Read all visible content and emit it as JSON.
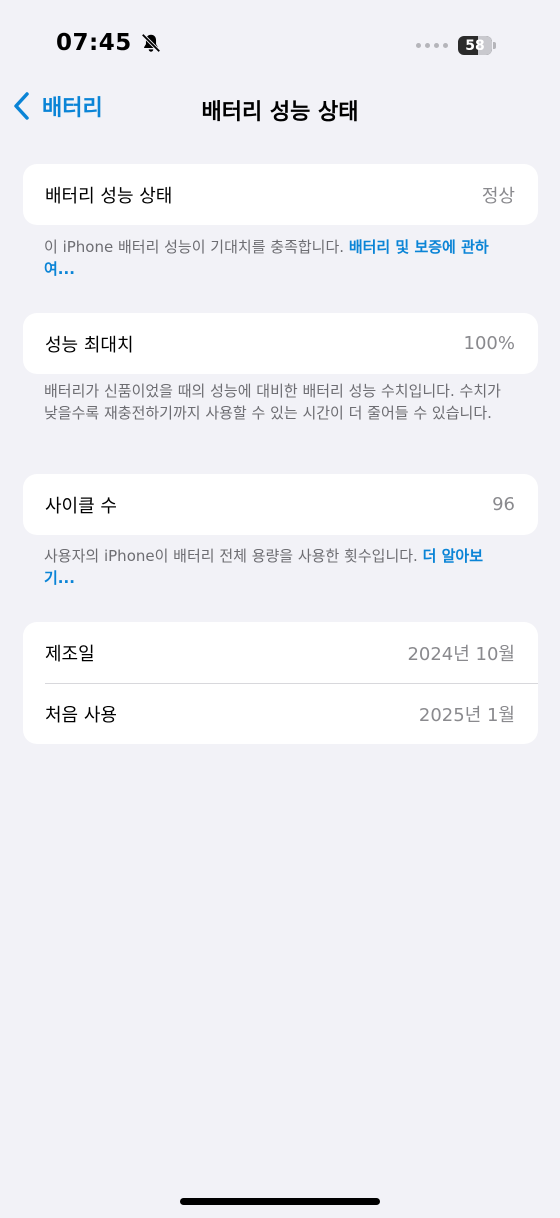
{
  "status_bar": {
    "time": "07:45",
    "battery_level": "58",
    "battery_fraction": 0.58,
    "silent_icon": "bell-slash-icon"
  },
  "nav": {
    "back_label": "배터리",
    "title": "배터리 성능 상태"
  },
  "sections": {
    "health": {
      "label": "배터리 성능 상태",
      "value": "정상",
      "footnote_text": "이 iPhone 배터리 성능이 기대치를 충족합니다. ",
      "footnote_link": "배터리 및 보증에 관하여..."
    },
    "capacity": {
      "label": "성능 최대치",
      "value": "100%",
      "footnote_text": "배터리가 신품이었을 때의 성능에 대비한 배터리 성능 수치입니다. 수치가 낮을수록 재충전하기까지 사용할 수 있는 시간이 더 줄어들 수 있습니다."
    },
    "cycles": {
      "label": "사이클 수",
      "value": "96",
      "footnote_text": "사용자의 iPhone이 배터리 전체 용량을 사용한 횟수입니다. ",
      "footnote_link": "더 알아보기..."
    },
    "dates": {
      "manufactured_label": "제조일",
      "manufactured_value": "2024년 10월",
      "first_use_label": "처음 사용",
      "first_use_value": "2025년 1월"
    }
  },
  "colors": {
    "background": "#f2f2f7",
    "accent": "#0a84d6",
    "secondary_text": "#8a8a8e"
  }
}
